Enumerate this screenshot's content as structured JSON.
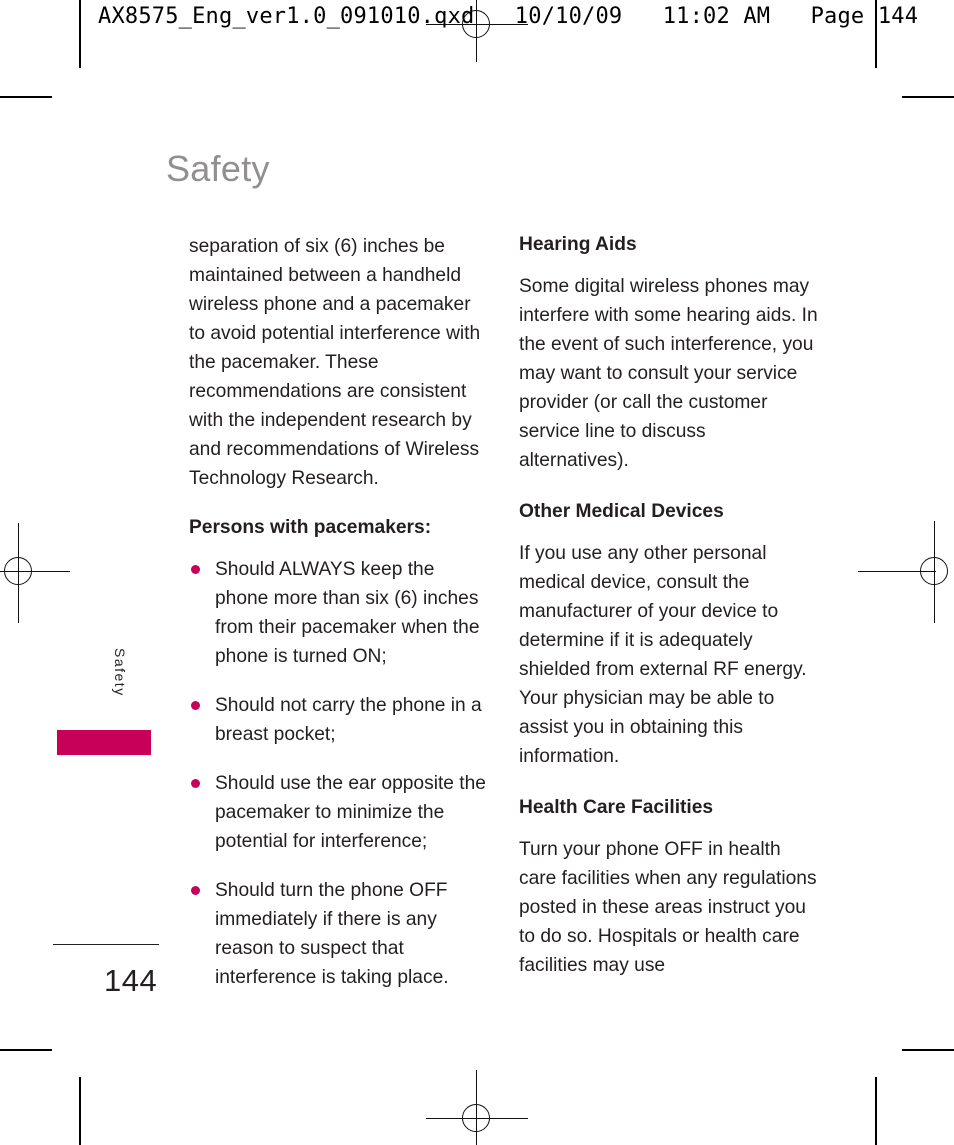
{
  "header": {
    "line": "AX8575_Eng_ver1.0_091010.qxd   10/10/09   11:02 AM   Page 144"
  },
  "chapter": {
    "title": "Safety",
    "side_tab_label": "Safety"
  },
  "folio": {
    "page_number": "144"
  },
  "colors": {
    "accent": "#c8005a",
    "title_gray": "#918f90",
    "body_text": "#231f20"
  },
  "left_column": {
    "continued_paragraph": "separation of six (6) inches be maintained between a handheld wireless phone and a pacemaker to avoid potential interference with the pacemaker. These recommendations are consistent with the independent research by and recommendations of Wireless Technology Research.",
    "subhead": "Persons with pacemakers:",
    "bullets": [
      "Should ALWAYS keep the phone more than six (6) inches from their pacemaker when the phone is turned ON;",
      "Should not carry the phone in a breast pocket;",
      "Should use the ear opposite the pacemaker to minimize the potential for interference;",
      "Should turn the phone OFF immediately if there is any reason to suspect that interference is taking place."
    ]
  },
  "right_column": {
    "sections": [
      {
        "heading": "Hearing Aids",
        "body": "Some digital wireless phones may interfere with some hearing aids. In the event of such interference, you may want to consult your service provider (or call the customer service line to discuss alternatives)."
      },
      {
        "heading": "Other Medical Devices",
        "body": "If you use any other personal medical device, consult the manufacturer of your device to determine if it is adequately shielded from external RF energy. Your physician may be able to assist you in obtaining this information."
      },
      {
        "heading": "Health Care Facilities",
        "body": "Turn your phone OFF in health care facilities when any regulations posted in these areas instruct you to do so. Hospitals or health care facilities may use"
      }
    ]
  }
}
